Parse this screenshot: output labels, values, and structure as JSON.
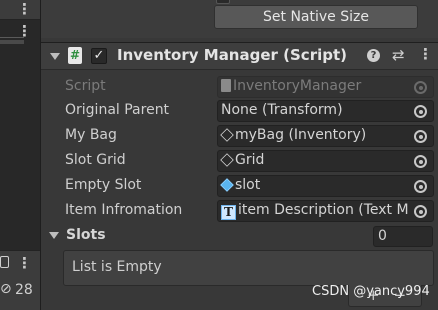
{
  "hierarchy": {
    "count_label": "28"
  },
  "inspector": {
    "native_size_button": "Set Native Size",
    "component": {
      "title": "Inventory Manager (Script)",
      "enable_check": "✓",
      "help_glyph": "?",
      "preset_glyph": "⇄",
      "menu_glyph": "⋮"
    },
    "properties": [
      {
        "label": "Script",
        "value": "InventoryManager",
        "icon": "script-file-icon",
        "disabled": true
      },
      {
        "label": "Original Parent",
        "value": "None (Transform)",
        "icon": "",
        "disabled": false
      },
      {
        "label": "My Bag",
        "value": "myBag (Inventory)",
        "icon": "scriptable-object-icon",
        "disabled": false
      },
      {
        "label": "Slot Grid",
        "value": "Grid",
        "icon": "gameobject-icon",
        "disabled": false
      },
      {
        "label": "Empty Slot",
        "value": "slot",
        "icon": "prefab-icon",
        "disabled": false
      },
      {
        "label": "Item Infromation",
        "value": "item Description (Text M",
        "icon": "text-component-icon",
        "disabled": false
      }
    ],
    "slots": {
      "label": "Slots",
      "count": "0",
      "empty_message": "List is Empty",
      "add_glyph": "+",
      "remove_glyph": "−"
    }
  },
  "watermark": "CSDN @yancy994",
  "colors": {
    "panel_bg": "#383838",
    "field_bg": "#2a2a2a",
    "script_icon_green": "#2f8f3f",
    "prefab_blue": "#5ab4ee"
  }
}
